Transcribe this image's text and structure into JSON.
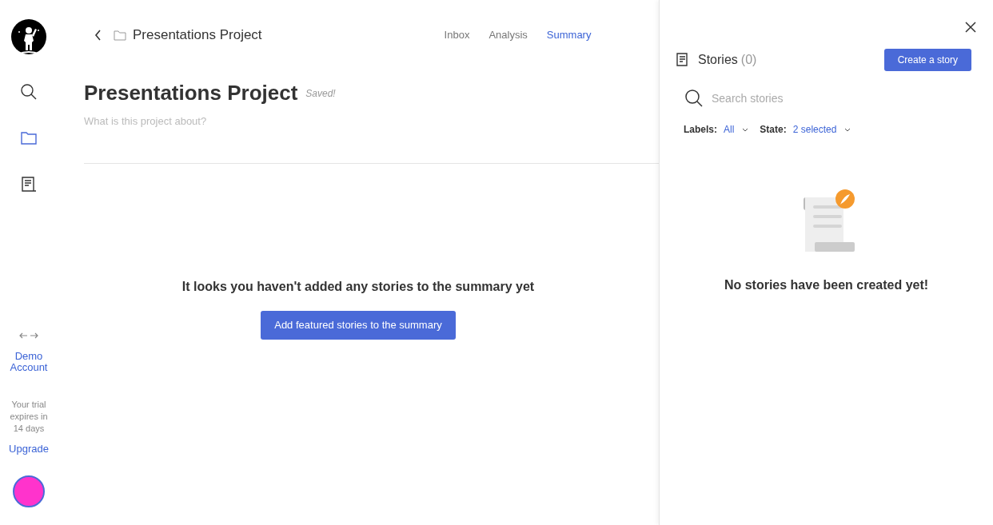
{
  "sidebar": {
    "items": [
      {
        "kind": "search",
        "selected": false
      },
      {
        "kind": "folder",
        "selected": true
      },
      {
        "kind": "stories",
        "selected": false
      }
    ],
    "account": "Demo Account",
    "trial": "Your trial expires in 14 days",
    "upgrade": "Upgrade"
  },
  "header": {
    "breadcrumb": "Presentations Project",
    "tabs": [
      {
        "label": "Inbox",
        "selected": false
      },
      {
        "label": "Analysis",
        "selected": false
      },
      {
        "label": "Summary",
        "selected": true
      }
    ]
  },
  "project": {
    "title": "Presentations Project",
    "status": "Saved!",
    "description_placeholder": "What is this project about?"
  },
  "empty_summary": {
    "message": "It looks you haven't added any stories to the summary yet",
    "button": "Add featured stories to the summary"
  },
  "stories_panel": {
    "title": "Stories",
    "count": "(0)",
    "create_button": "Create a story",
    "search_placeholder": "Search stories",
    "filters": [
      {
        "label": "Labels:",
        "value": "All"
      },
      {
        "label": "State:",
        "value": "2 selected"
      }
    ],
    "empty_message": "No stories have been created yet!"
  }
}
